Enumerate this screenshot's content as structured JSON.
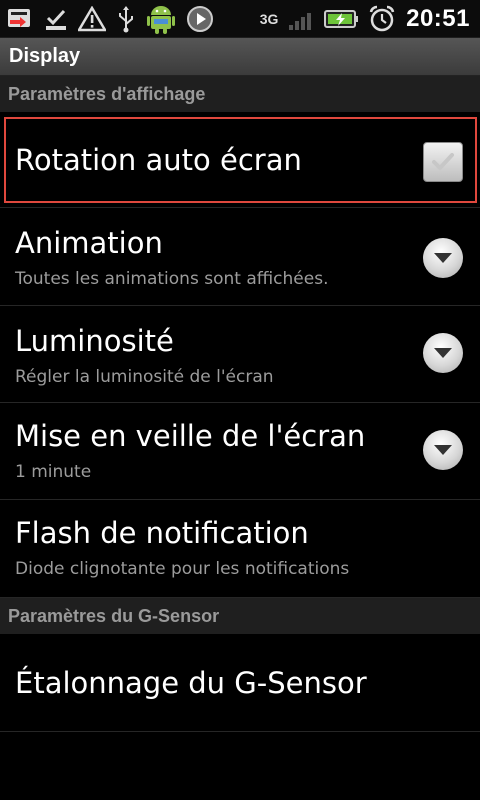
{
  "status_bar": {
    "network_type": "3G",
    "time": "20:51"
  },
  "header": {
    "title": "Display"
  },
  "sections": {
    "display_settings": {
      "label": "Paramètres d'affichage"
    },
    "gsensor_settings": {
      "label": "Paramètres du G-Sensor"
    }
  },
  "items": {
    "rotation": {
      "title": "Rotation auto écran",
      "checked": true
    },
    "animation": {
      "title": "Animation",
      "summary": "Toutes les animations sont affichées."
    },
    "brightness": {
      "title": "Luminosité",
      "summary": "Régler la luminosité de l'écran"
    },
    "sleep": {
      "title": "Mise en veille de l'écran",
      "summary": "1 minute"
    },
    "notification_flash": {
      "title": "Flash de notification",
      "summary": "Diode clignotante pour les notifications"
    },
    "gsensor_calibration": {
      "title": "Étalonnage du G-Sensor"
    }
  },
  "icons": {
    "status_left": [
      "usb-transfer-icon",
      "download-complete-icon",
      "warning-icon",
      "usb-icon",
      "android-icon",
      "media-play-icon"
    ],
    "status_right": [
      "3g-data-icon",
      "signal-bars-icon",
      "battery-charging-icon",
      "alarm-clock-icon"
    ],
    "row_controls": [
      "checkbox-checked-icon",
      "dropdown-arrow-icon"
    ]
  },
  "colors": {
    "background": "#000000",
    "highlight_border": "#e0483d",
    "summary_text": "#9c9c9c",
    "section_text": "#9a9a9a"
  }
}
